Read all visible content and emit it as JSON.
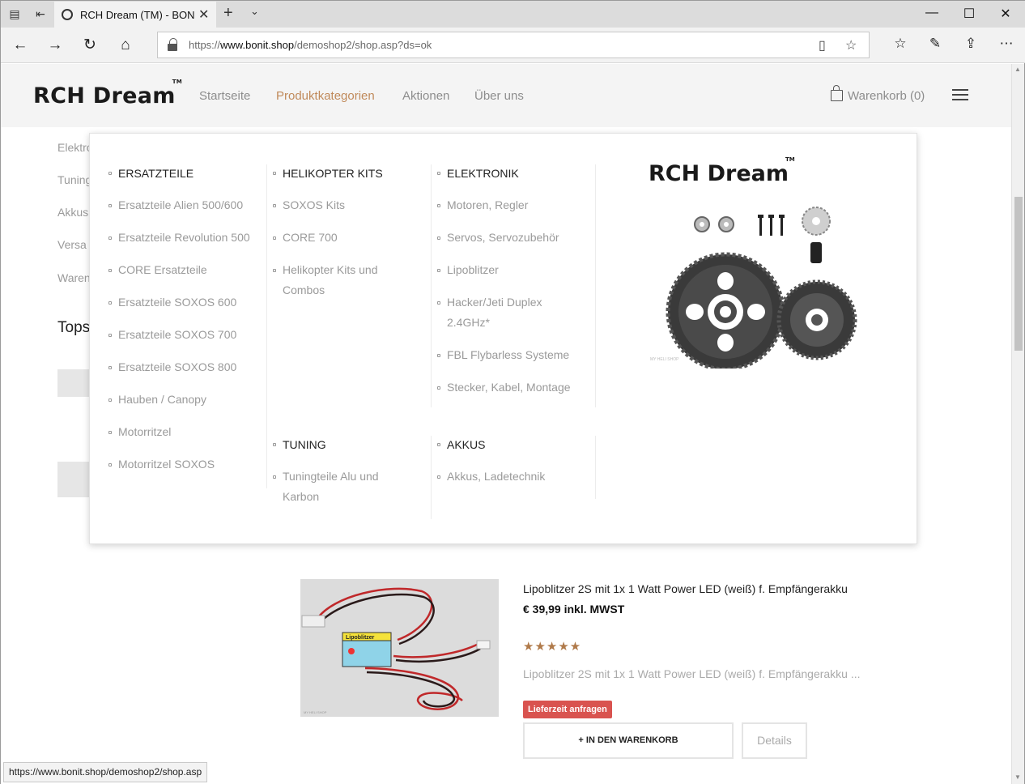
{
  "browser": {
    "tab_title": "RCH Dream (TM) - BON",
    "address_host_prefix": "https://",
    "address_host": "www.bonit.shop",
    "address_path": "/demoshop2/shop.asp?ds=ok",
    "status_url": "https://www.bonit.shop/demoshop2/shop.asp"
  },
  "site": {
    "logo_text": "RCH Dream",
    "logo_mark": "TM",
    "nav": [
      "Startseite",
      "Produktkategorien",
      "Aktionen",
      "Über uns"
    ],
    "active_nav": "Produktkategorien",
    "cart_label": "Warenkorb (0)"
  },
  "background": {
    "side_items": [
      "Elektro",
      "Tuning",
      "Akkus",
      "Versa",
      "Waren"
    ],
    "section_title": "Tops"
  },
  "mega_menu": {
    "columns": [
      {
        "heading": "ERSATZTEILE",
        "links": [
          "Ersatzteile Alien 500/600",
          "Ersatzteile Revolution 500",
          "CORE Ersatzteile",
          "Ersatzteile SOXOS 600",
          "Ersatzteile SOXOS 700",
          "Ersatzteile SOXOS 800",
          "Hauben / Canopy",
          "Motorritzel",
          "Motorritzel SOXOS"
        ]
      },
      {
        "heading": "HELIKOPTER KITS",
        "links": [
          "SOXOS Kits",
          "CORE 700",
          "Helikopter Kits und Combos"
        ]
      },
      {
        "heading": "ELEKTRONIK",
        "links": [
          "Motoren, Regler",
          "Servos, Servozubehör",
          "Lipoblitzer",
          "Hacker/Jeti Duplex 2.4GHz*",
          "FBL Flybarless Systeme",
          "Stecker, Kabel, Montage"
        ]
      },
      {
        "heading": "TUNING",
        "links": [
          "Tuningteile Alu und Karbon"
        ]
      },
      {
        "heading": "AKKUS",
        "links": [
          "Akkus, Ladetechnik"
        ]
      }
    ],
    "promo_logo": "RCH Dream",
    "promo_logo_mark": "TM",
    "promo_caption": "MY HELI SHOP"
  },
  "product": {
    "title": "Lipoblitzer 2S mit 1x 1 Watt Power LED (weiß) f. Empfängerakku",
    "price": "€ 39,99 inkl. MWST",
    "rating": 5,
    "stars": "★★★★★",
    "description": "Lipoblitzer 2S mit 1x 1 Watt Power LED (weiß) f. Empfängerakku ...",
    "badge": "Lieferzeit anfragen",
    "add_to_cart": "+ IN DEN WARENKORB",
    "details": "Details",
    "image_label": "Lipoblitzer",
    "image_caption": "MY HELI SHOP"
  },
  "colors": {
    "accent": "#c08a5b",
    "star": "#b07a4a",
    "badge": "#d9534f"
  }
}
